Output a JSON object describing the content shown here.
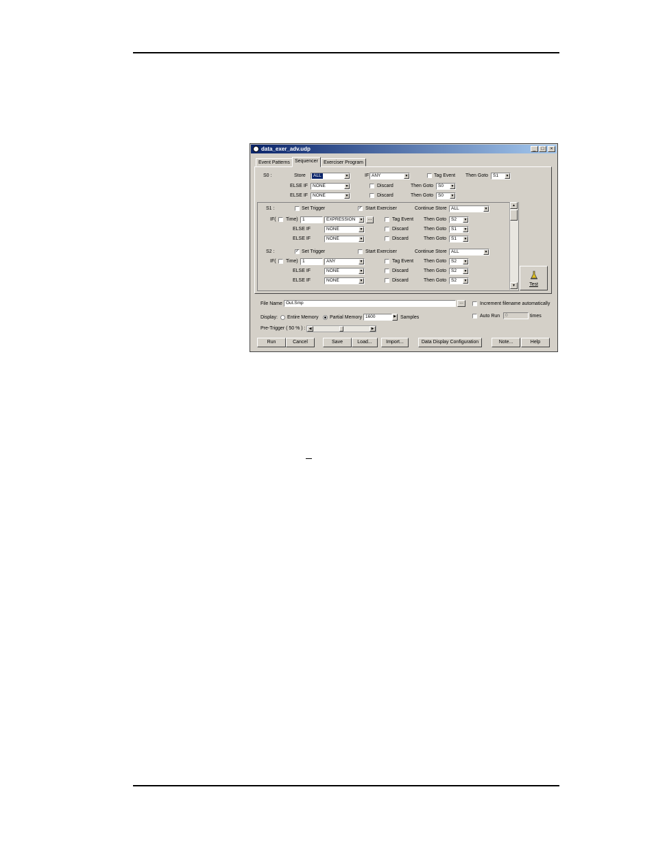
{
  "window": {
    "title": "data_exer_adv.udp"
  },
  "tabs": [
    {
      "label": "Event Patterns"
    },
    {
      "label": "Sequencer"
    },
    {
      "label": "Exerciser Program"
    }
  ],
  "s0": {
    "state": "S0 :",
    "store_label": "Store",
    "store_value": "ALL",
    "if_label": "IF",
    "if_value": "ANY",
    "tag_event": "Tag Event",
    "then_goto_label": "Then Goto",
    "then_goto_value": "S1",
    "else_rows": [
      {
        "label": "ELSE IF",
        "value": "NONE",
        "discard": "Discard",
        "then_goto_label": "Then Goto",
        "then_goto_value": "S0"
      },
      {
        "label": "ELSE IF",
        "value": "NONE",
        "discard": "Discard",
        "then_goto_label": "Then Goto",
        "then_goto_value": "S0"
      }
    ]
  },
  "s1": {
    "state": "S1 :",
    "set_trigger": "Set Trigger",
    "start_exerciser": "Start Exerciser",
    "continue_store_label": "Continue Store",
    "continue_store_value": "ALL",
    "if_label": "IF(",
    "time_label": "Time)",
    "time_value": "1",
    "condition_value": "EXPRESSION",
    "more_label": "...",
    "tag_event": "Tag Event",
    "then_goto_label": "Then Goto",
    "then_goto_value": "S2",
    "else_rows": [
      {
        "label": "ELSE IF",
        "value": "NONE",
        "discard": "Discard",
        "then_goto_label": "Then Goto",
        "then_goto_value": "S1"
      },
      {
        "label": "ELSE IF",
        "value": "NONE",
        "discard": "Discard",
        "then_goto_label": "Then Goto",
        "then_goto_value": "S1"
      }
    ]
  },
  "s2": {
    "state": "S2 :",
    "set_trigger": "Set Trigger",
    "start_exerciser": "Start Exerciser",
    "continue_store_label": "Continue Store",
    "continue_store_value": "ALL",
    "if_label": "IF(",
    "time_label": "Time)",
    "time_value": "1",
    "condition_value": "ANY",
    "tag_event": "Tag Event",
    "then_goto_label": "Then Goto",
    "then_goto_value": "S2",
    "else_rows": [
      {
        "label": "ELSE IF",
        "value": "NONE",
        "discard": "Discard",
        "then_goto_label": "Then Goto",
        "then_goto_value": "S2"
      },
      {
        "label": "ELSE IF",
        "value": "NONE",
        "discard": "Discard",
        "then_goto_label": "Then Goto",
        "then_goto_value": "S2"
      }
    ]
  },
  "test_button": {
    "label": "Test"
  },
  "file": {
    "name_label": "File Name",
    "name_value": "Out.Smp",
    "browse_label": "...",
    "increment_label": "Increment filename automatically"
  },
  "display": {
    "label": "Display:",
    "entire_memory": "Entire Memory",
    "partial_memory": "Partial Memory",
    "samples_value": "1600",
    "samples_label": "Samples",
    "auto_run_label": "Auto Run",
    "auto_run_value": "0",
    "times_label": "times"
  },
  "pretrigger": {
    "label": "Pre-Trigger ( 50 % ) :",
    "percent": 50
  },
  "buttons": {
    "run": "Run",
    "cancel": "Cancel",
    "save": "Save",
    "load": "Load...",
    "import": "Import...",
    "ddc": "Data Display Configuration",
    "note": "Note...",
    "help": "Help"
  },
  "colors": {
    "title_start": "#0a246a",
    "title_end": "#a6caf0",
    "face": "#d4d0c8"
  }
}
